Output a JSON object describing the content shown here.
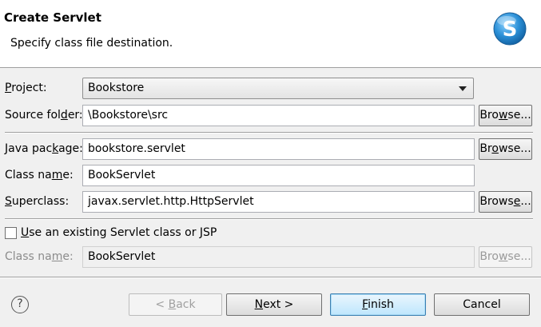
{
  "header": {
    "title": "Create Servlet",
    "subtitle": "Specify class file destination.",
    "logo_icon": "servlet-s-logo-icon"
  },
  "form": {
    "project": {
      "label": "Project:",
      "value": "Bookstore"
    },
    "source_folder": {
      "label": "Source folder:",
      "value": "\\Bookstore\\src"
    },
    "java_package": {
      "label": "Java package:",
      "value": "bookstore.servlet"
    },
    "class_name": {
      "label": "Class name:",
      "value": "BookServlet"
    },
    "superclass": {
      "label": "Superclass:",
      "value": "javax.servlet.http.HttpServlet"
    },
    "browse_label": "Browse...",
    "use_existing": {
      "label": "Use an existing Servlet class or JSP",
      "checked": false
    },
    "existing_class_name": {
      "label": "Class name:",
      "value": "BookServlet"
    }
  },
  "footer": {
    "help_icon": "help-icon",
    "back_label": "< Back",
    "next_label": "Next >",
    "finish_label": "Finish",
    "cancel_label": "Cancel"
  },
  "colors": {
    "accent": "#3c7fb1",
    "logo_blue": "#2a8fd6"
  }
}
